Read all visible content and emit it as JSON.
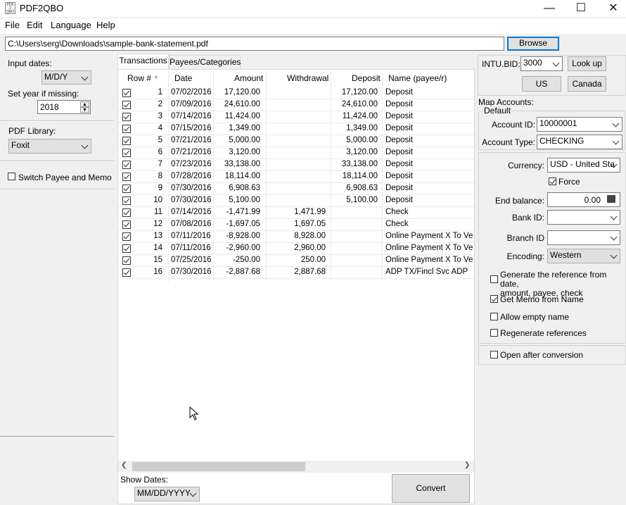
{
  "window": {
    "title": "PDF2QBO",
    "logo_text": "PDF 2 QBO",
    "minimize": "—",
    "maximize": "☐",
    "close": "✕"
  },
  "menu": [
    "File",
    "Edit",
    "Language",
    "Help"
  ],
  "file_path": "C:\\Users\\serg\\Downloads\\sample-bank-statement.pdf",
  "browse_label": "Browse",
  "left": {
    "input_dates_label": "Input dates:",
    "input_dates_value": "M/D/Y",
    "set_year_label": "Set year if missing:",
    "year_value": "2018",
    "pdf_library_label": "PDF Library:",
    "pdf_library_value": "Foxit",
    "switch_label": "Switch Payee and Memo"
  },
  "tabs": [
    "Transactions",
    "Payees/Categories"
  ],
  "columns": [
    "Row #",
    "Date",
    "Amount",
    "Withdrawal",
    "Deposit",
    "Name (payee/r)"
  ],
  "rows": [
    {
      "n": "1",
      "date": "07/02/2016",
      "amount": "17,120.00",
      "withdrawal": "",
      "deposit": "17,120.00",
      "name": "Deposit"
    },
    {
      "n": "2",
      "date": "07/09/2016",
      "amount": "24,610.00",
      "withdrawal": "",
      "deposit": "24,610.00",
      "name": "Deposit"
    },
    {
      "n": "3",
      "date": "07/14/2016",
      "amount": "11,424.00",
      "withdrawal": "",
      "deposit": "11,424.00",
      "name": "Deposit"
    },
    {
      "n": "4",
      "date": "07/15/2016",
      "amount": "1,349.00",
      "withdrawal": "",
      "deposit": "1,349.00",
      "name": "Deposit"
    },
    {
      "n": "5",
      "date": "07/21/2016",
      "amount": "5,000.00",
      "withdrawal": "",
      "deposit": "5,000.00",
      "name": "Deposit"
    },
    {
      "n": "6",
      "date": "07/21/2016",
      "amount": "3,120.00",
      "withdrawal": "",
      "deposit": "3,120.00",
      "name": "Deposit"
    },
    {
      "n": "7",
      "date": "07/23/2016",
      "amount": "33,138.00",
      "withdrawal": "",
      "deposit": "33,138.00",
      "name": "Deposit"
    },
    {
      "n": "8",
      "date": "07/28/2016",
      "amount": "18,114.00",
      "withdrawal": "",
      "deposit": "18,114.00",
      "name": "Deposit"
    },
    {
      "n": "9",
      "date": "07/30/2016",
      "amount": "6,908.63",
      "withdrawal": "",
      "deposit": "6,908.63",
      "name": "Deposit"
    },
    {
      "n": "10",
      "date": "07/30/2016",
      "amount": "5,100.00",
      "withdrawal": "",
      "deposit": "5,100.00",
      "name": "Deposit"
    },
    {
      "n": "11",
      "date": "07/14/2016",
      "amount": "-1,471.99",
      "withdrawal": "1,471.99",
      "deposit": "",
      "name": "Check"
    },
    {
      "n": "12",
      "date": "07/08/2016",
      "amount": "-1,697.05",
      "withdrawal": "1,697.05",
      "deposit": "",
      "name": "Check"
    },
    {
      "n": "13",
      "date": "07/11/2016",
      "amount": "-8,928.00",
      "withdrawal": "8,928.00",
      "deposit": "",
      "name": "Online Payment X To Vendor"
    },
    {
      "n": "14",
      "date": "07/11/2016",
      "amount": "-2,960.00",
      "withdrawal": "2,960.00",
      "deposit": "",
      "name": "Online Payment X To Vendor"
    },
    {
      "n": "15",
      "date": "07/25/2016",
      "amount": "-250.00",
      "withdrawal": "250.00",
      "deposit": "",
      "name": "Online Payment X To Vendor"
    },
    {
      "n": "16",
      "date": "07/30/2016",
      "amount": "-2,887.68",
      "withdrawal": "2,887.68",
      "deposit": "",
      "name": "ADP TX/Fincl Svc ADP"
    }
  ],
  "show_dates_label": "Show Dates:",
  "show_dates_value": "MM/DD/YYYY",
  "convert_label": "Convert",
  "right": {
    "intu_bid_label": "INTU.BID:",
    "intu_bid_value": "3000",
    "lookup_label": "Look up",
    "us_label": "US",
    "canada_label": "Canada",
    "map_accounts_label": "Map Accounts:",
    "default_label": "Default",
    "account_id_label": "Account ID:",
    "account_id_value": "10000001",
    "account_type_label": "Account Type:",
    "account_type_value": "CHECKING",
    "currency_label": "Currency:",
    "currency_value": "USD - United Sta",
    "force_label": "Force",
    "end_balance_label": "End balance:",
    "end_balance_value": "0.00",
    "bank_id_label": "Bank ID:",
    "branch_id_label": "Branch ID",
    "encoding_label": "Encoding:",
    "encoding_value": "Western",
    "gen_ref_label_1": "Generate the reference from date,",
    "gen_ref_label_2": "amount, payee, check",
    "memo_label": "Get Memo from Name",
    "allow_empty_label": "Allow empty name",
    "regen_label": "Regenerate references",
    "open_after_label": "Open after conversion"
  }
}
